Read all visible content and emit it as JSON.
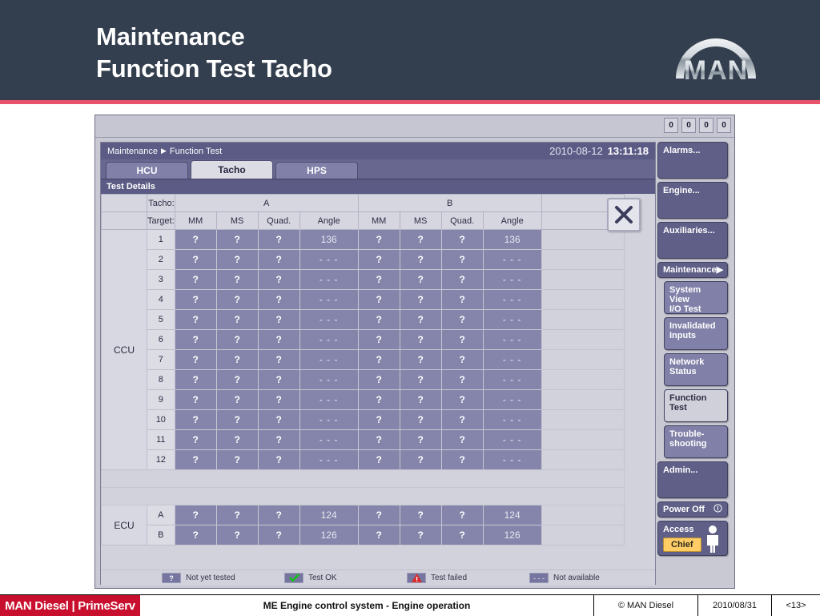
{
  "slide": {
    "title": "Maintenance\nFunction Test Tacho",
    "logo_alt": "man-logo"
  },
  "footer": {
    "brand": "MAN Diesel | PrimeServ",
    "center": "ME Engine control system - Engine operation",
    "copyright": "© MAN Diesel",
    "date": "2010/08/31",
    "page": "<13>"
  },
  "panel": {
    "counters": [
      "0",
      "0",
      "0",
      "0"
    ],
    "breadcrumb": {
      "root": "Maintenance",
      "arrow": "▶",
      "leaf": "Function Test"
    },
    "datetime": {
      "date": "2010-08-12",
      "time": "13:11:18"
    },
    "tabs": [
      {
        "label": "HCU",
        "active": false
      },
      {
        "label": "Tacho",
        "active": true
      },
      {
        "label": "HPS",
        "active": false
      }
    ],
    "section_title": "Test Details",
    "close_label": "×"
  },
  "table": {
    "row_label_tacho": "Tacho:",
    "row_label_target": "Target:",
    "groups": [
      "A",
      "B"
    ],
    "columns": [
      "MM",
      "MS",
      "Quad.",
      "Angle"
    ],
    "ccu_label": "CCU",
    "ecu_label": "ECU",
    "ccu_rows": [
      {
        "idx": "1",
        "a": [
          "?",
          "?",
          "?",
          "136"
        ],
        "b": [
          "?",
          "?",
          "?",
          "136"
        ]
      },
      {
        "idx": "2",
        "a": [
          "?",
          "?",
          "?",
          "- - -"
        ],
        "b": [
          "?",
          "?",
          "?",
          "- - -"
        ]
      },
      {
        "idx": "3",
        "a": [
          "?",
          "?",
          "?",
          "- - -"
        ],
        "b": [
          "?",
          "?",
          "?",
          "- - -"
        ]
      },
      {
        "idx": "4",
        "a": [
          "?",
          "?",
          "?",
          "- - -"
        ],
        "b": [
          "?",
          "?",
          "?",
          "- - -"
        ]
      },
      {
        "idx": "5",
        "a": [
          "?",
          "?",
          "?",
          "- - -"
        ],
        "b": [
          "?",
          "?",
          "?",
          "- - -"
        ]
      },
      {
        "idx": "6",
        "a": [
          "?",
          "?",
          "?",
          "- - -"
        ],
        "b": [
          "?",
          "?",
          "?",
          "- - -"
        ]
      },
      {
        "idx": "7",
        "a": [
          "?",
          "?",
          "?",
          "- - -"
        ],
        "b": [
          "?",
          "?",
          "?",
          "- - -"
        ]
      },
      {
        "idx": "8",
        "a": [
          "?",
          "?",
          "?",
          "- - -"
        ],
        "b": [
          "?",
          "?",
          "?",
          "- - -"
        ]
      },
      {
        "idx": "9",
        "a": [
          "?",
          "?",
          "?",
          "- - -"
        ],
        "b": [
          "?",
          "?",
          "?",
          "- - -"
        ]
      },
      {
        "idx": "10",
        "a": [
          "?",
          "?",
          "?",
          "- - -"
        ],
        "b": [
          "?",
          "?",
          "?",
          "- - -"
        ]
      },
      {
        "idx": "11",
        "a": [
          "?",
          "?",
          "?",
          "- - -"
        ],
        "b": [
          "?",
          "?",
          "?",
          "- - -"
        ]
      },
      {
        "idx": "12",
        "a": [
          "?",
          "?",
          "?",
          "- - -"
        ],
        "b": [
          "?",
          "?",
          "?",
          "- - -"
        ]
      }
    ],
    "ecu_rows": [
      {
        "idx": "A",
        "a": [
          "?",
          "?",
          "?",
          "124"
        ],
        "b": [
          "?",
          "?",
          "?",
          "124"
        ]
      },
      {
        "idx": "B",
        "a": [
          "?",
          "?",
          "?",
          "126"
        ],
        "b": [
          "?",
          "?",
          "?",
          "126"
        ]
      }
    ]
  },
  "legend": [
    {
      "swatch": "?",
      "text": "Not yet tested"
    },
    {
      "swatch": "check",
      "text": "Test OK"
    },
    {
      "swatch": "alarm",
      "text": "Test failed"
    },
    {
      "swatch": "- - -",
      "text": "Not available"
    }
  ],
  "sidebar": {
    "top_buttons": [
      {
        "label": "Alarms..."
      },
      {
        "label": "Engine..."
      },
      {
        "label": "Auxiliaries..."
      }
    ],
    "group": {
      "label": "Maintenance",
      "arrow": "▶"
    },
    "sub_buttons": [
      {
        "label": "System View\nI/O Test",
        "active": false
      },
      {
        "label": "Invalidated\nInputs",
        "active": false
      },
      {
        "label": "Network\nStatus",
        "active": false
      },
      {
        "label": "Function\nTest",
        "active": true
      },
      {
        "label": "Trouble-\nshooting",
        "active": false
      }
    ],
    "admin": {
      "label": "Admin..."
    },
    "power_off": {
      "label": "Power Off",
      "icon": "info-icon"
    },
    "access": {
      "label": "Access",
      "level": "Chief"
    }
  },
  "colors": {
    "header_bg": "#333f4e",
    "accent_rule": "#e8536b",
    "brand_red": "#c8102e",
    "panel_bg": "#c9c9d4",
    "title_bar": "#5b5b85",
    "data_cell": "#8585ab",
    "badge_amber": "#ffcc66"
  }
}
